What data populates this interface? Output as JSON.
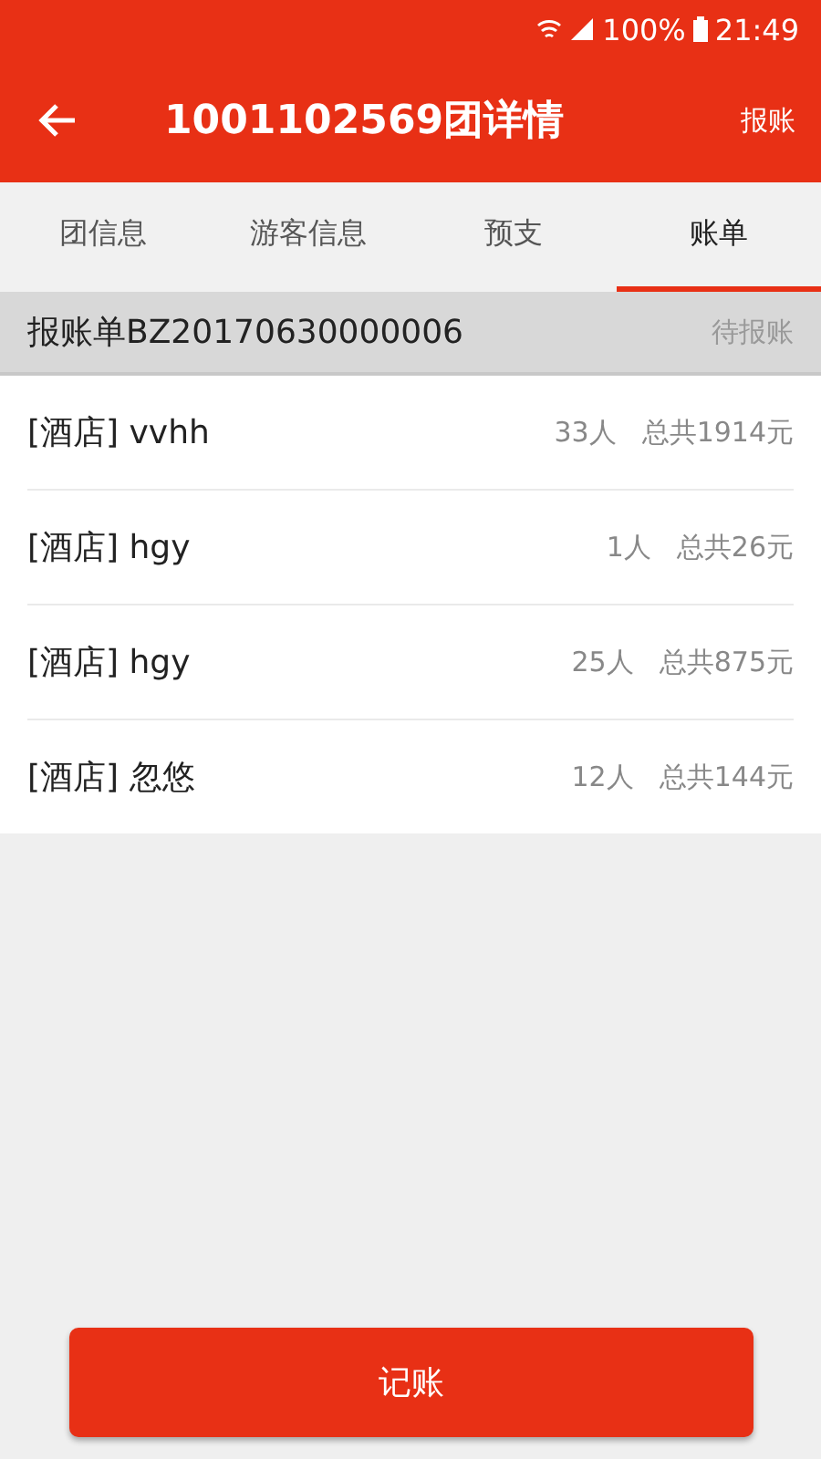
{
  "status_bar": {
    "battery": "100%",
    "time": "21:49"
  },
  "app_bar": {
    "title": "1001102569团详情",
    "action": "报账"
  },
  "tabs": [
    {
      "label": "团信息",
      "selected": false
    },
    {
      "label": "游客信息",
      "selected": false
    },
    {
      "label": "预支",
      "selected": false
    },
    {
      "label": "账单",
      "selected": true
    }
  ],
  "bill": {
    "number": "报账单BZ20170630000006",
    "status": "待报账"
  },
  "items": [
    {
      "name": "[酒店] vvhh",
      "people": "33人",
      "total": "总共1914元"
    },
    {
      "name": "[酒店] hgy",
      "people": "1人",
      "total": "总共26元"
    },
    {
      "name": "[酒店] hgy",
      "people": "25人",
      "total": "总共875元"
    },
    {
      "name": "[酒店] 忽悠",
      "people": "12人",
      "total": "总共144元"
    }
  ],
  "button": "记账"
}
